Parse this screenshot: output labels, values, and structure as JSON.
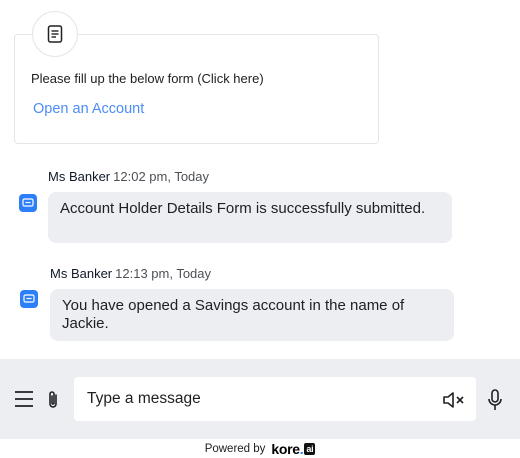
{
  "form_card": {
    "text": "Please fill up the below form (Click here)",
    "link_label": "Open an Account"
  },
  "messages": [
    {
      "sender": "Ms Banker",
      "time": "12:02 pm, Today",
      "text": "Account Holder Details Form is successfully submitted."
    },
    {
      "sender": "Ms Banker",
      "time": "12:13 pm, Today",
      "text": "You have opened a Savings account in the name of Jackie."
    }
  ],
  "composer": {
    "placeholder": "Type a message"
  },
  "footer": {
    "powered_by": "Powered by",
    "brand_main": "kore",
    "brand_dot": ".",
    "brand_ai": "ai"
  },
  "colors": {
    "accent": "#2d7ff9",
    "link": "#4b8df8",
    "bubble": "#eceef1",
    "composer_bg": "#eceef1"
  },
  "icons": [
    "form-icon",
    "bot-avatar-icon",
    "menu-icon",
    "attach-icon",
    "mute-icon",
    "mic-icon"
  ]
}
